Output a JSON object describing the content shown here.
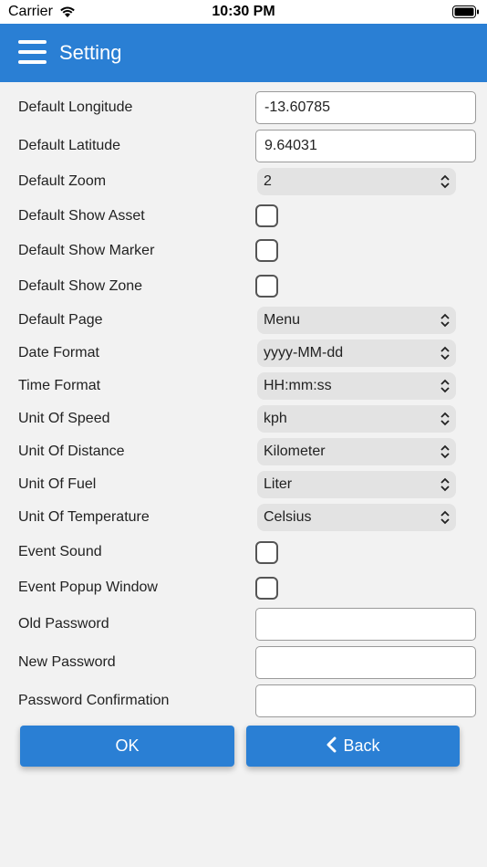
{
  "status_bar": {
    "carrier": "Carrier",
    "time": "10:30 PM"
  },
  "header": {
    "title": "Setting",
    "menu_icon": "hamburger-menu-icon",
    "color": "#2a7fd4"
  },
  "fields": {
    "default_longitude": {
      "label": "Default Longitude",
      "value": "-13.60785"
    },
    "default_latitude": {
      "label": "Default Latitude",
      "value": "9.64031"
    },
    "default_zoom": {
      "label": "Default Zoom",
      "value": "2"
    },
    "default_show_asset": {
      "label": "Default Show Asset",
      "checked": false
    },
    "default_show_marker": {
      "label": "Default Show Marker",
      "checked": false
    },
    "default_show_zone": {
      "label": "Default Show Zone",
      "checked": false
    },
    "default_page": {
      "label": "Default Page",
      "value": "Menu"
    },
    "date_format": {
      "label": "Date Format",
      "value": "yyyy-MM-dd"
    },
    "time_format": {
      "label": "Time Format",
      "value": "HH:mm:ss"
    },
    "unit_of_speed": {
      "label": "Unit Of Speed",
      "value": "kph"
    },
    "unit_of_distance": {
      "label": "Unit Of Distance",
      "value": "Kilometer"
    },
    "unit_of_fuel": {
      "label": "Unit Of Fuel",
      "value": "Liter"
    },
    "unit_of_temperature": {
      "label": "Unit Of Temperature",
      "value": "Celsius"
    },
    "event_sound": {
      "label": "Event Sound",
      "checked": false
    },
    "event_popup_window": {
      "label": "Event Popup Window",
      "checked": false
    },
    "old_password": {
      "label": "Old Password",
      "value": ""
    },
    "new_password": {
      "label": "New Password",
      "value": ""
    },
    "password_confirmation": {
      "label": "Password Confirmation",
      "value": ""
    }
  },
  "buttons": {
    "ok": "OK",
    "back": "Back",
    "back_icon": "chevron-left-icon"
  }
}
